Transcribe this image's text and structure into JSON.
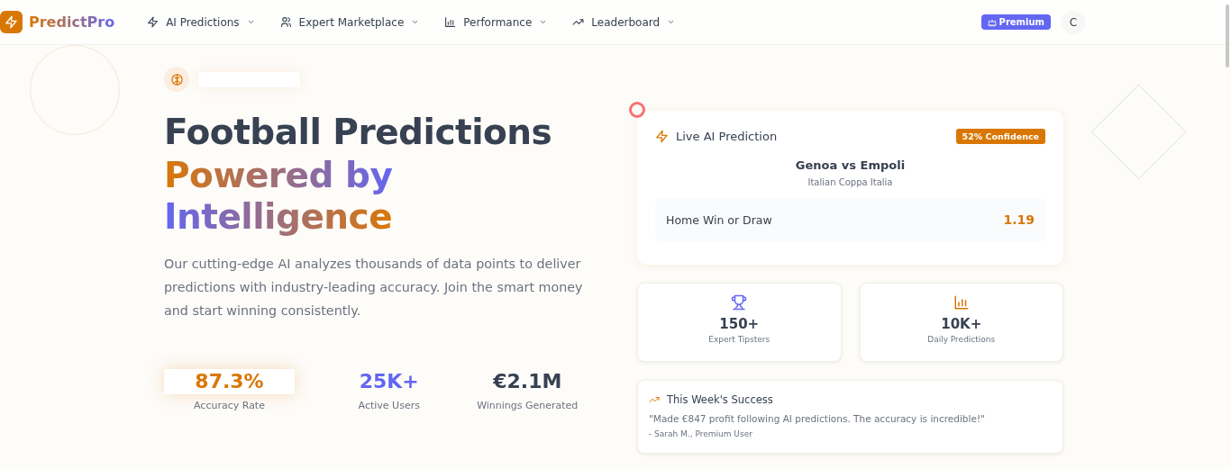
{
  "brand": {
    "name": "PredictPro"
  },
  "nav": [
    {
      "label": "AI Predictions",
      "kind": "bolt"
    },
    {
      "label": "Expert Marketplace",
      "kind": "users"
    },
    {
      "label": "Performance",
      "kind": "bars"
    },
    {
      "label": "Leaderboard",
      "kind": "trend"
    }
  ],
  "premium_button": {
    "label": "Premium"
  },
  "avatar": {
    "initial": "C"
  },
  "hero": {
    "title_line": "Football Predictions",
    "gradient_lines": [
      "Powered by",
      "Intelligence"
    ],
    "description": "Our cutting-edge AI analyzes thousands of data points to deliver predictions with industry-leading accuracy. Join the smart money and start winning consistently.",
    "stats": [
      {
        "value": "87.3%",
        "label": "Accuracy Rate",
        "color": "#d97706",
        "highlighted": true
      },
      {
        "value": "25K+",
        "label": "Active Users",
        "color": "#6366f1",
        "highlighted": false
      },
      {
        "value": "€2.1M",
        "label": "Winnings Generated",
        "color": "#374151",
        "highlighted": false
      }
    ]
  },
  "prediction_card": {
    "title": "Live AI Prediction",
    "confidence": "52% Confidence",
    "match": "Genoa vs Empoli",
    "competition": "Italian Coppa Italia",
    "pick": "Home Win or Draw",
    "odds": "1.19"
  },
  "tiles": [
    {
      "kind": "trophy",
      "value": "150+",
      "label": "Expert Tipsters"
    },
    {
      "kind": "chart",
      "value": "10K+",
      "label": "Daily Predictions"
    }
  ],
  "testimonial": {
    "title": "This Week's Success",
    "quote": "\"Made €847 profit following AI predictions. The accuracy is incredible!\"",
    "author": "- Sarah M., Premium User"
  }
}
